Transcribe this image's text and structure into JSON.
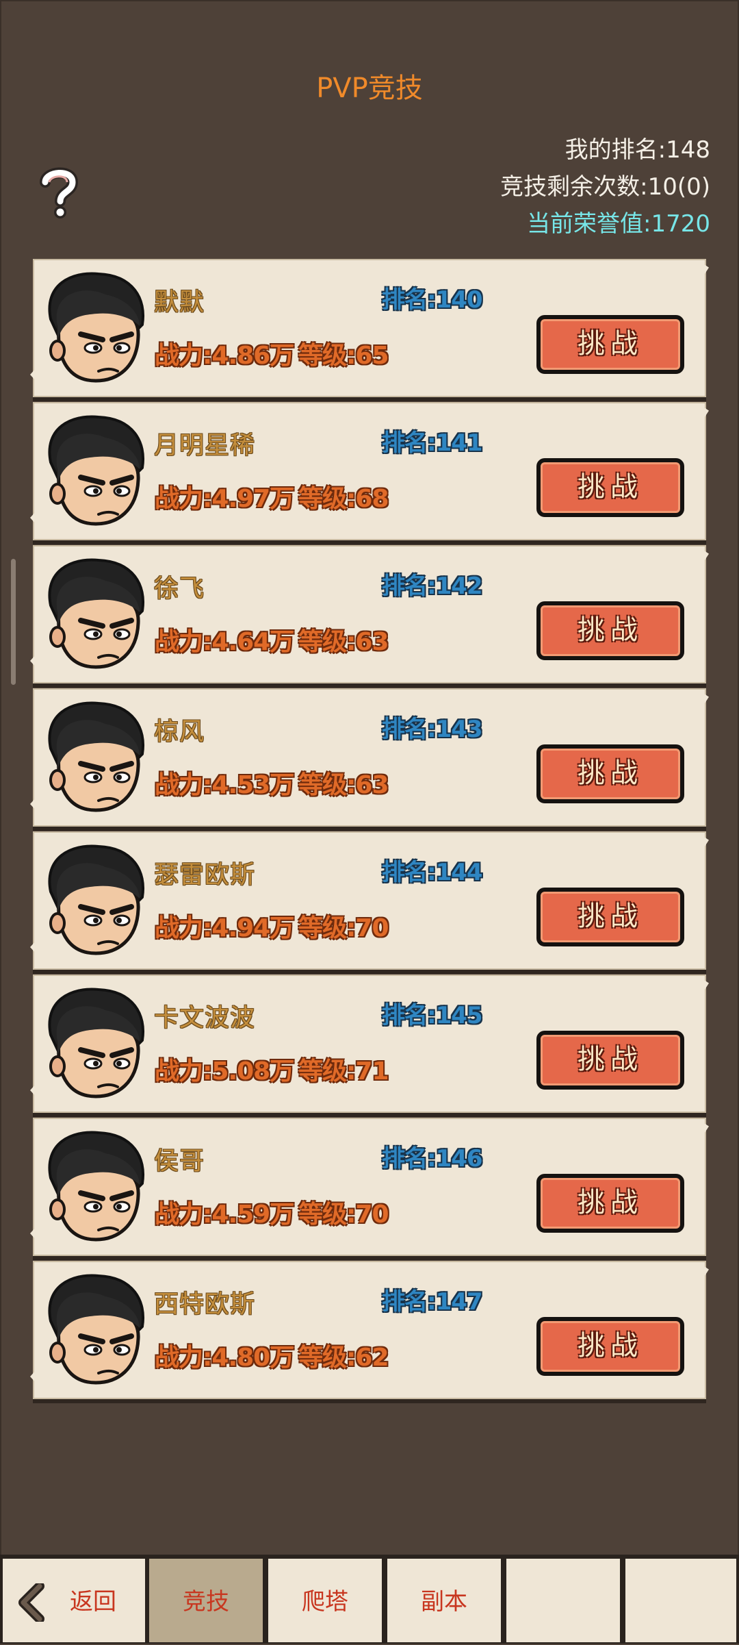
{
  "header": {
    "title": "PVP竞技"
  },
  "stats": {
    "my_rank": "我的排名:148",
    "remaining": "竞技剩余次数:10(0)",
    "honor": "当前荣誉值:1720"
  },
  "opponents": [
    {
      "name": "默默",
      "rank": "排名:140",
      "power": "战力:4.86万",
      "level": "等级:65",
      "button": "挑战"
    },
    {
      "name": "月明星稀",
      "rank": "排名:141",
      "power": "战力:4.97万",
      "level": "等级:68",
      "button": "挑战"
    },
    {
      "name": "徐飞",
      "rank": "排名:142",
      "power": "战力:4.64万",
      "level": "等级:63",
      "button": "挑战"
    },
    {
      "name": "椋风",
      "rank": "排名:143",
      "power": "战力:4.53万",
      "level": "等级:63",
      "button": "挑战"
    },
    {
      "name": "瑟雷欧斯",
      "rank": "排名:144",
      "power": "战力:4.94万",
      "level": "等级:70",
      "button": "挑战"
    },
    {
      "name": "卡文波波",
      "rank": "排名:145",
      "power": "战力:5.08万",
      "level": "等级:71",
      "button": "挑战"
    },
    {
      "name": "侯哥",
      "rank": "排名:146",
      "power": "战力:4.59万",
      "level": "等级:70",
      "button": "挑战"
    },
    {
      "name": "西特欧斯",
      "rank": "排名:147",
      "power": "战力:4.80万",
      "level": "等级:62",
      "button": "挑战"
    }
  ],
  "tabs": [
    {
      "label": "返回"
    },
    {
      "label": "竞技"
    },
    {
      "label": "爬塔"
    },
    {
      "label": "副本"
    },
    {
      "label": ""
    },
    {
      "label": ""
    }
  ],
  "icons": {
    "help": "question-icon",
    "back": "back-arrow-icon",
    "avatar": "hero-avatar-icon"
  },
  "colors": {
    "background": "#4e4138",
    "card": "#efe6d6",
    "button": "#e5684a",
    "title": "#f08a2a",
    "honor": "#77e6e8"
  }
}
